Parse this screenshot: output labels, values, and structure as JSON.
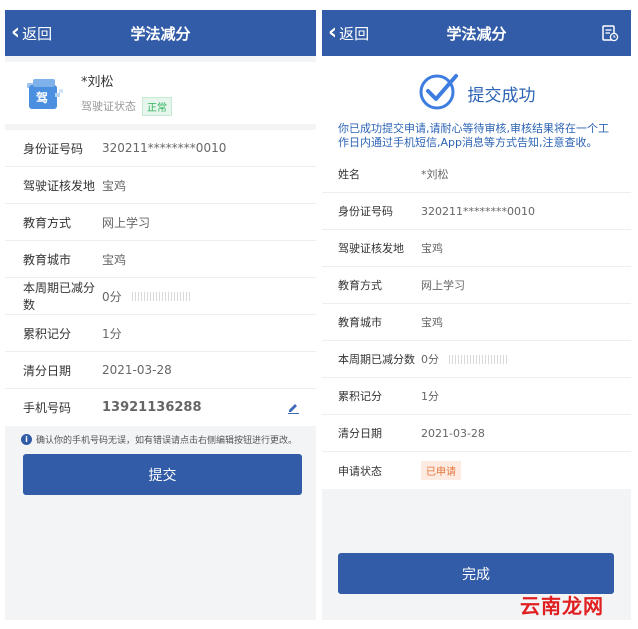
{
  "left": {
    "back_label": "返回",
    "title": "学法减分",
    "profile": {
      "icon_char": "驾",
      "name": "*刘松",
      "status_label": "驾驶证状态",
      "status_badge": "正常"
    },
    "rows": [
      {
        "label": "身份证号码",
        "value": "320211********0010"
      },
      {
        "label": "驾驶证核发地",
        "value": "宝鸡"
      },
      {
        "label": "教育方式",
        "value": "网上学习"
      },
      {
        "label": "教育城市",
        "value": "宝鸡"
      },
      {
        "label": "本周期已减分数",
        "value": "0分"
      },
      {
        "label": "累积记分",
        "value": "1分"
      },
      {
        "label": "清分日期",
        "value": "2021-03-28"
      },
      {
        "label": "手机号码",
        "value": "13921136288"
      }
    ],
    "note": "确认你的手机号码无误，如有错误请点击右侧编辑按钮进行更改。",
    "submit_label": "提交"
  },
  "right": {
    "back_label": "返回",
    "title": "学法减分",
    "success_title": "提交成功",
    "success_text": "你已成功提交申请,请耐心等待审核,审核结果将在一个工作日内通过手机短信,App消息等方式告知,注意查收。",
    "rows": [
      {
        "label": "姓名",
        "value": "*刘松"
      },
      {
        "label": "身份证号码",
        "value": "320211********0010"
      },
      {
        "label": "驾驶证核发地",
        "value": "宝鸡"
      },
      {
        "label": "教育方式",
        "value": "网上学习"
      },
      {
        "label": "教育城市",
        "value": "宝鸡"
      },
      {
        "label": "本周期已减分数",
        "value": "0分"
      },
      {
        "label": "累积记分",
        "value": "1分"
      },
      {
        "label": "清分日期",
        "value": "2021-03-28"
      },
      {
        "label": "申请状态",
        "value": "已申请"
      }
    ],
    "done_label": "完成"
  },
  "watermark": "云南龙网",
  "colors": {
    "nav": "#325ca7",
    "link": "#2d64b5",
    "ok": "#31b15e",
    "applied": "#e7773a"
  }
}
